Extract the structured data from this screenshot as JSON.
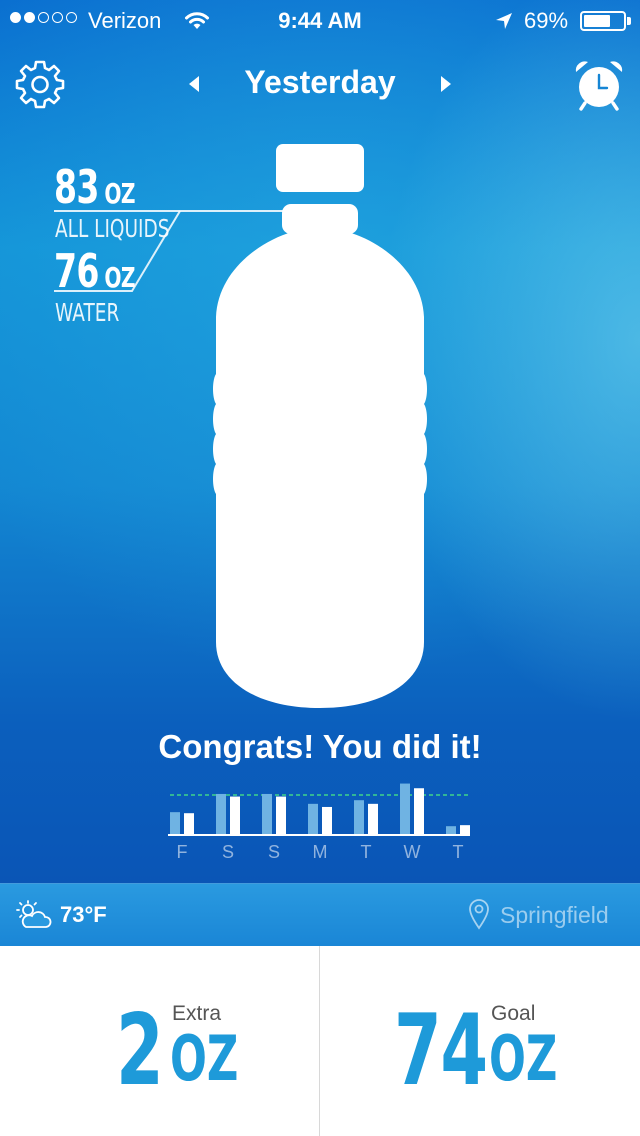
{
  "status_bar": {
    "carrier": "Verizon",
    "signal_bars_filled": 2,
    "signal_bars_total": 5,
    "time": "9:44 AM",
    "battery_percent": "69%",
    "battery_level": 0.69,
    "icons": [
      "wifi-icon",
      "location-arrow-icon",
      "battery-icon"
    ]
  },
  "header": {
    "title": "Yesterday",
    "left_icon": "gear-icon",
    "prev_icon": "triangle-left-icon",
    "next_icon": "triangle-right-icon",
    "right_icon": "alarm-clock-icon"
  },
  "stats": {
    "all_liquids_value": "83",
    "all_liquids_unit": "OZ",
    "all_liquids_label": "ALL LIQUIDS",
    "water_value": "76",
    "water_unit": "OZ",
    "water_label": "WATER"
  },
  "bottle": {
    "fill_fraction": 1.0,
    "icon": "water-bottle-icon"
  },
  "message": "Congrats! You did it!",
  "week_chart": {
    "days": [
      "F",
      "S",
      "S",
      "M",
      "T",
      "W",
      "T"
    ],
    "liquids": [
      0.42,
      0.77,
      0.77,
      0.58,
      0.65,
      0.97,
      0.15
    ],
    "water": [
      0.4,
      0.72,
      0.72,
      0.52,
      0.58,
      0.88,
      0.17
    ],
    "goal_line": 0.75,
    "colors": {
      "liquids": "#6fb3e3",
      "water": "#ffffff",
      "goal": "#3fd48a"
    }
  },
  "weather": {
    "icon": "partly-cloudy-icon",
    "temperature": "73°F",
    "location_icon": "location-pin-icon",
    "city": "Springfield"
  },
  "summary": {
    "extra_value": "2",
    "extra_unit": "OZ",
    "extra_label": "Extra",
    "goal_value": "74",
    "goal_unit": "OZ",
    "goal_label": "Goal"
  },
  "colors": {
    "hero_top": "#0a6fd0",
    "hero_mid": "#1394d8",
    "accent": "#1e9ad9",
    "weather_bar": "#1a86d6"
  }
}
